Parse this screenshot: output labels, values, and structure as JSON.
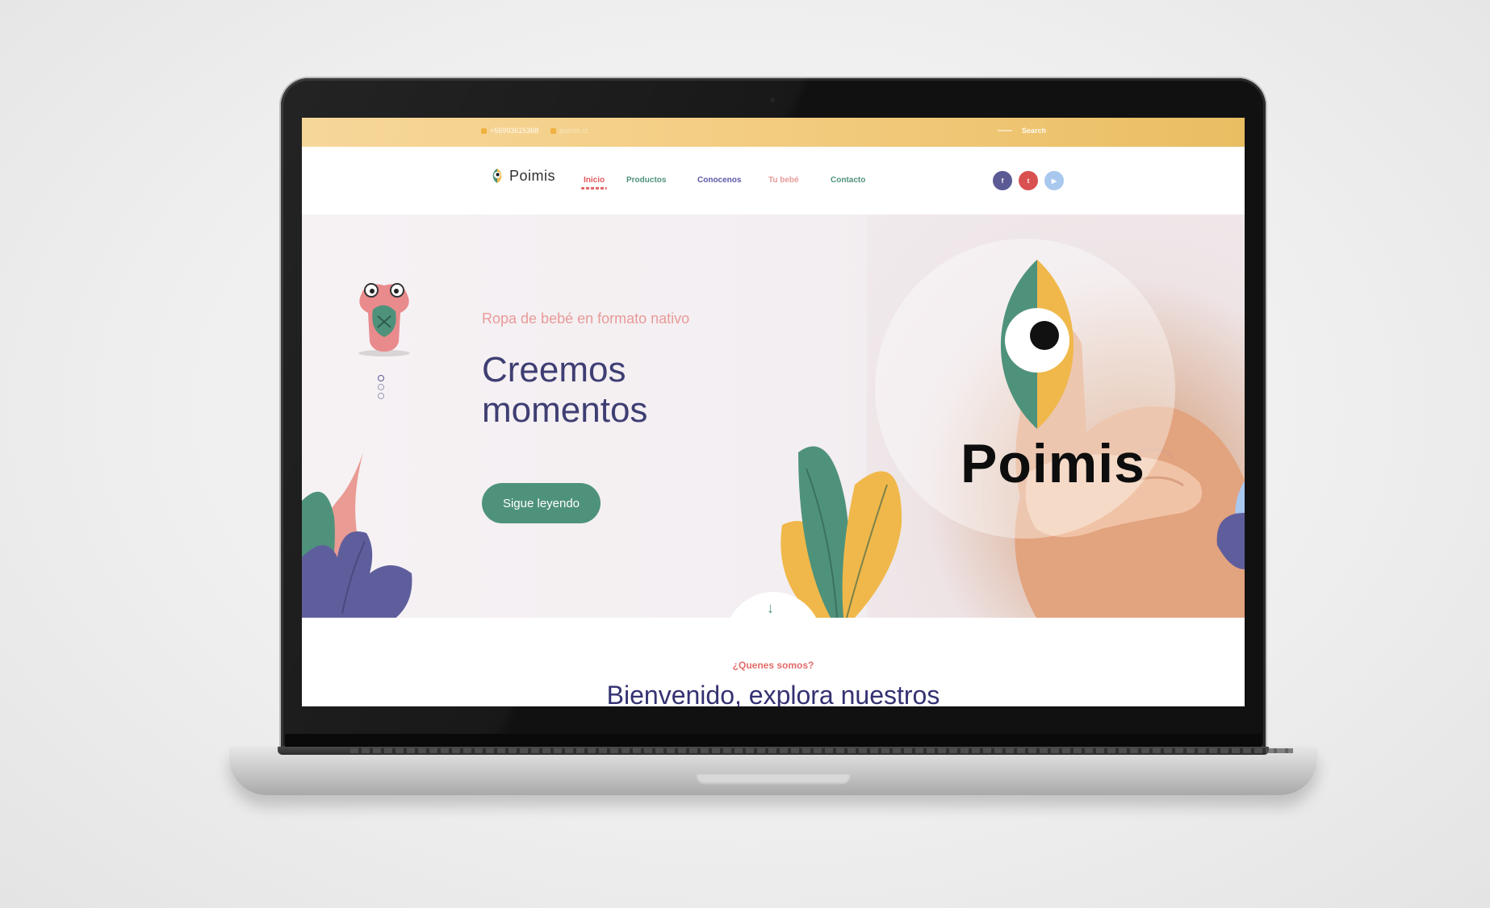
{
  "topbar": {
    "phone": "+56993615368",
    "email": "poimis.cl",
    "search_placeholder": "Search"
  },
  "nav": {
    "brand": "Poimis",
    "links": [
      {
        "label": "Inicio",
        "color": "#e2585d",
        "active": true
      },
      {
        "label": "Productos",
        "color": "#4f927b",
        "active": false
      },
      {
        "label": "Conocenos",
        "color": "#5a58a4",
        "active": false
      },
      {
        "label": "Tu bebé",
        "color": "#e79a98",
        "active": false
      },
      {
        "label": "Contacto",
        "color": "#4f927b",
        "active": false
      }
    ],
    "social": [
      {
        "name": "facebook-icon",
        "glyph": "f",
        "color": "#5b5a94"
      },
      {
        "name": "twitter-icon",
        "glyph": "t",
        "color": "#d95050"
      },
      {
        "name": "youtube-icon",
        "glyph": "▶",
        "color": "#a9c8ee"
      }
    ]
  },
  "hero": {
    "tagline": "Ropa de bebé en formato nativo",
    "title_line1": "Creemos",
    "title_line2": "momentos",
    "cta": "Sigue leyendo",
    "logo_text": "Poimis",
    "slides": 3,
    "active_slide": 0
  },
  "about": {
    "kicker": "¿Quenes somos?",
    "title": "Bienvenido, explora nuestros"
  },
  "colors": {
    "brand_green": "#4f927b",
    "brand_yellow": "#f0b84a",
    "brand_navy": "#3f3e73",
    "brand_pink": "#e79a98"
  }
}
